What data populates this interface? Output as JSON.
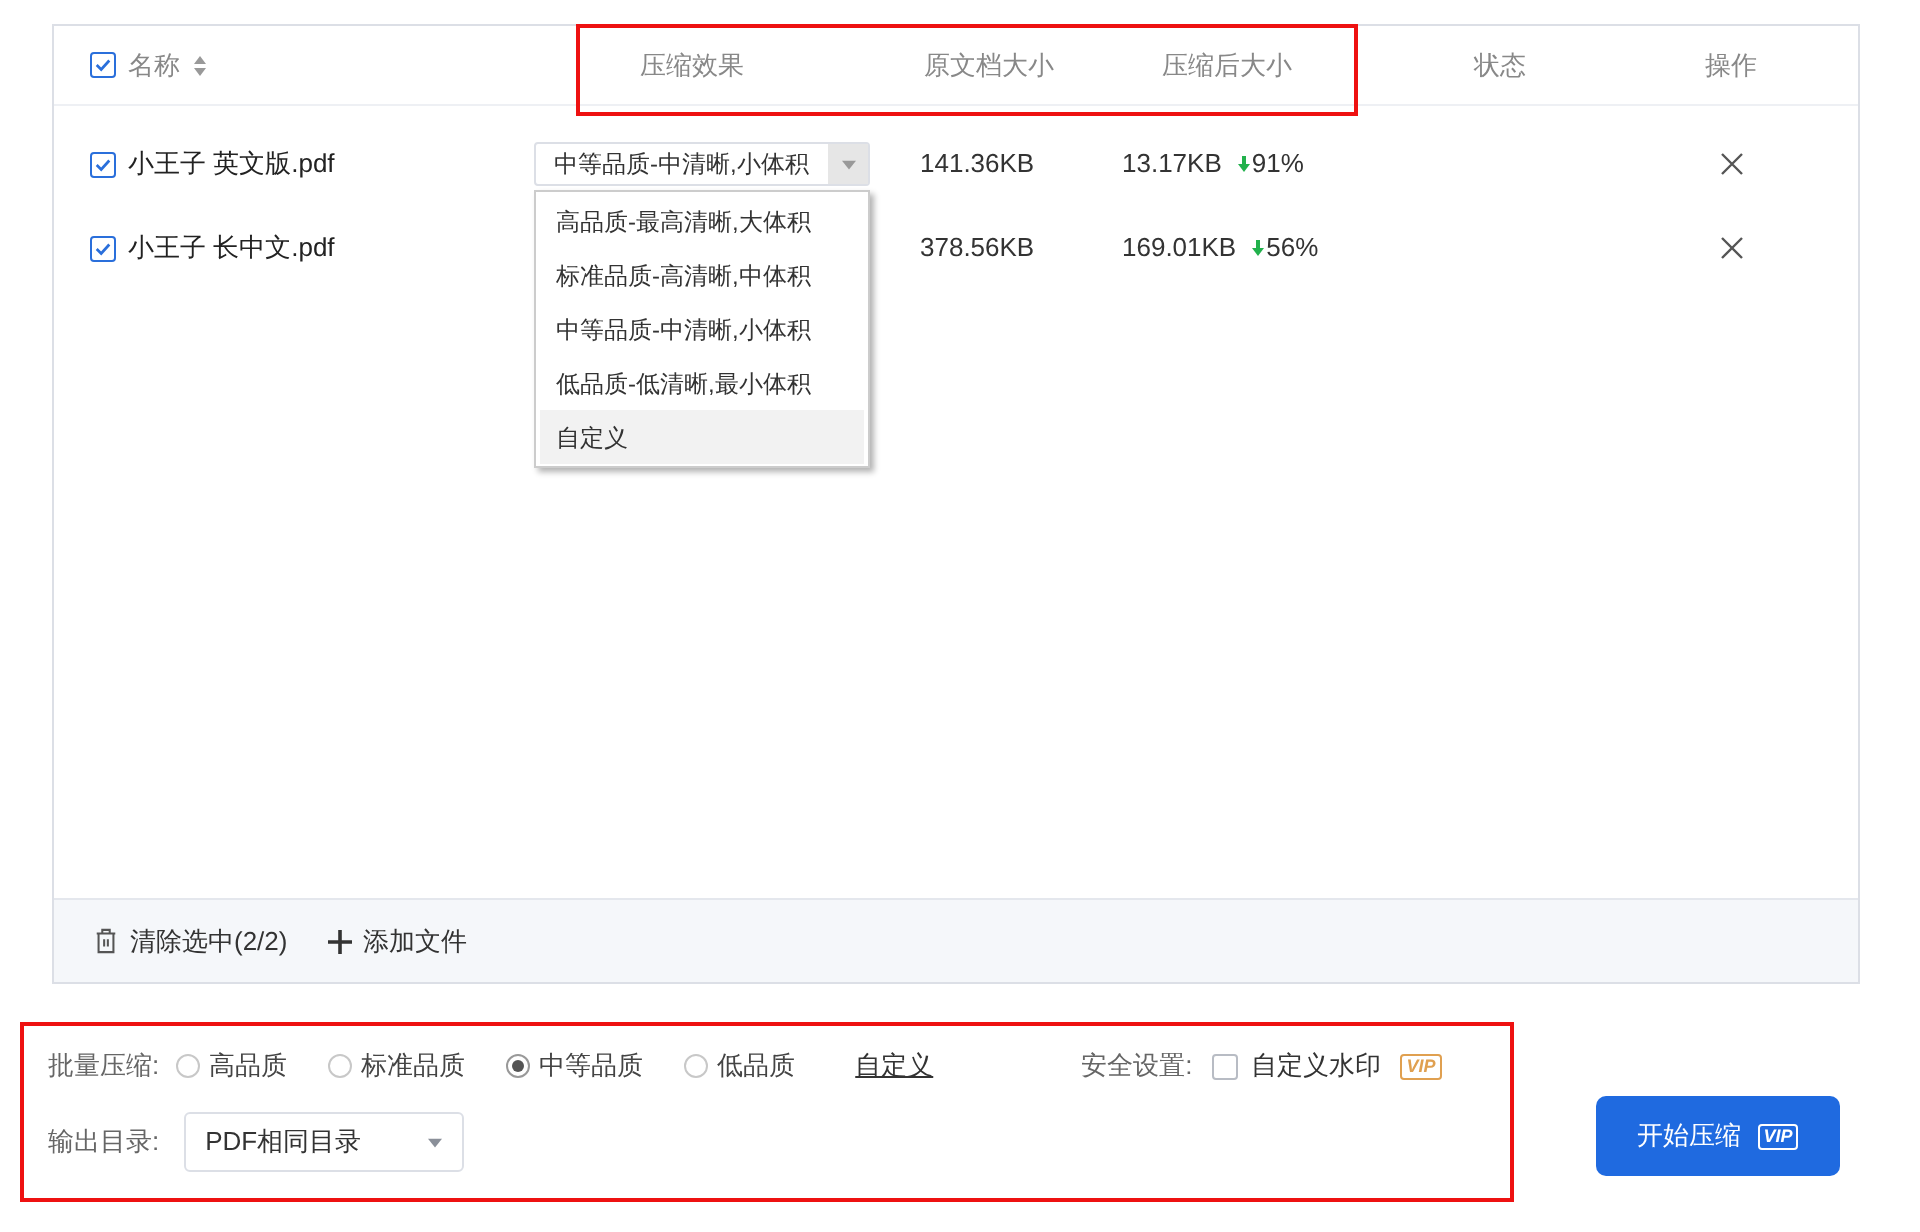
{
  "table": {
    "select_all": {
      "checked": true
    },
    "columns": [
      {
        "label": "名称",
        "sortable": true
      },
      {
        "label": "压缩效果",
        "sortable": false
      },
      {
        "label": "原文档大小",
        "sortable": false
      },
      {
        "label": "压缩后大小",
        "sortable": false
      },
      {
        "label": "状态",
        "sortable": false
      },
      {
        "label": "操作",
        "sortable": false
      }
    ],
    "rows": [
      {
        "checked": true,
        "name": "小王子 英文版.pdf",
        "effect": "中等品质-中清晰,小体积",
        "original": "141.36KB",
        "compressed": "13.17KB",
        "reduction": "91%"
      },
      {
        "checked": true,
        "name": "小王子 长中文.pdf",
        "original": "378.56KB",
        "compressed": "169.01KB",
        "reduction": "56%"
      }
    ],
    "effect_menu": [
      {
        "label": "高品质-最高清晰,大体积",
        "highlighted": false
      },
      {
        "label": "标准品质-高清晰,中体积",
        "highlighted": false
      },
      {
        "label": "中等品质-中清晰,小体积",
        "highlighted": false
      },
      {
        "label": "低品质-低清晰,最小体积",
        "highlighted": false
      },
      {
        "label": "自定义",
        "highlighted": true
      }
    ],
    "footer": {
      "clear": "清除选中(2/2)",
      "add": "添加文件"
    }
  },
  "batch": {
    "label": "批量压缩:",
    "options": [
      {
        "label": "高品质",
        "selected": false
      },
      {
        "label": "标准品质",
        "selected": false
      },
      {
        "label": "中等品质",
        "selected": true
      },
      {
        "label": "低品质",
        "selected": false
      }
    ],
    "custom_link": "自定义"
  },
  "security": {
    "label": "安全设置:",
    "watermark": {
      "label": "自定义水印",
      "checked": false,
      "badge": "VIP"
    }
  },
  "output": {
    "label": "输出目录:",
    "value": "PDF相同目录"
  },
  "start_button": {
    "label": "开始压缩",
    "badge": "VIP"
  }
}
